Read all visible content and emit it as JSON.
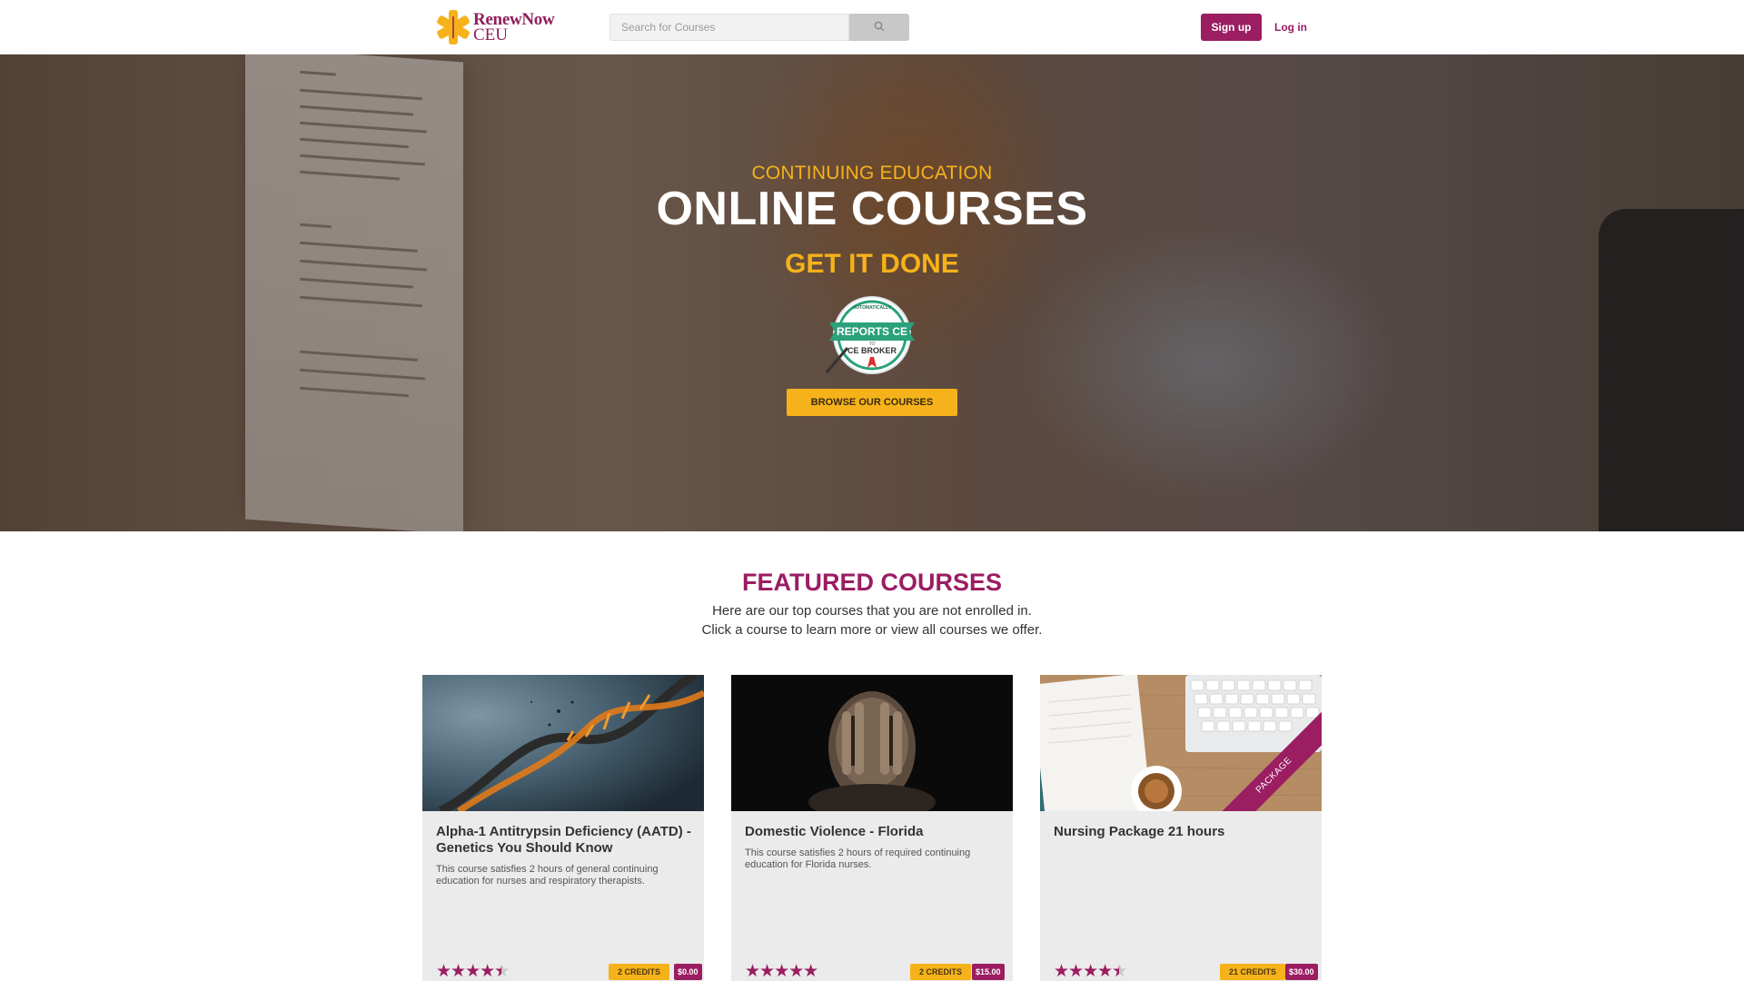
{
  "header": {
    "logo_line1": "RenewNow",
    "logo_line2": "CEU",
    "search_placeholder": "Search for Courses",
    "signup_label": "Sign up",
    "login_label": "Log in"
  },
  "hero": {
    "kicker": "CONTINUING EDUCATION",
    "title": "ONLINE COURSES",
    "tagline": "GET IT DONE",
    "badge": {
      "top": "AUTOMATICALLY",
      "main": "REPORTS CE",
      "to": "TO",
      "brand": "CE BROKER"
    },
    "cta_label": "BROWSE OUR COURSES"
  },
  "featured": {
    "title": "FEATURED COURSES",
    "subtitle_line1": "Here are our top courses that you are not enrolled in.",
    "subtitle_line2": "Click a course to learn more or view all courses we offer."
  },
  "courses": [
    {
      "title": "Alpha-1 Antitrypsin Deficiency (AATD) - Genetics You Should Know",
      "description": "This course satisfies 2 hours of general continuing education for nurses and respiratory therapists.",
      "rating": 4.5,
      "stars": "★★★★",
      "half_star": "★",
      "credits": "2 CREDITS",
      "price": "$0.00",
      "image": "dna-helix"
    },
    {
      "title": "Domestic Violence - Florida",
      "description": "This course satisfies 2 hours of required continuing education for Florida nurses.",
      "rating": 5,
      "stars": "★★★★★",
      "credits": "2 CREDITS",
      "price": "$15.00",
      "image": "person-covering-face"
    },
    {
      "title": "Nursing Package 21 hours",
      "description": "",
      "rating": 4.5,
      "stars": "★★★★",
      "half_star": "★",
      "credits": "21 CREDITS",
      "price": "$30.00",
      "ribbon": "PACKAGE",
      "image": "desk-notebook-coffee"
    }
  ],
  "colors": {
    "brand_purple": "#9b1d62",
    "brand_gold": "#f6b21a"
  }
}
